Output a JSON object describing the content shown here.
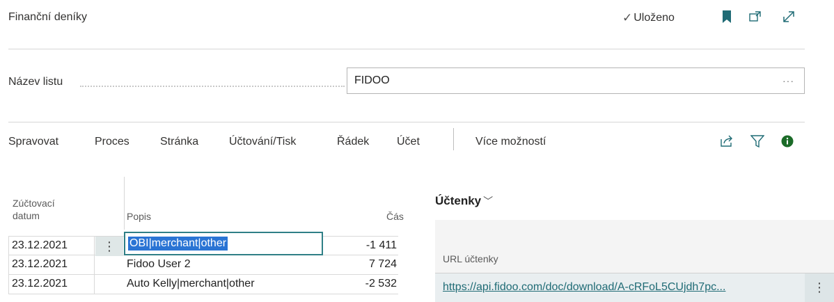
{
  "header": {
    "title": "Finanční deníky",
    "status": "Uloženo",
    "icons": [
      "check-icon",
      "bookmark-icon",
      "open-in-new-window-icon",
      "expand-icon"
    ]
  },
  "field": {
    "label": "Název listu",
    "value": "FIDOO",
    "more": "···"
  },
  "actions": {
    "items": [
      "Spravovat",
      "Proces",
      "Stránka",
      "Účtování/Tisk",
      "Řádek",
      "Účet"
    ],
    "more_label": "Více možností",
    "icons": [
      "share-icon",
      "filter-icon",
      "info-icon"
    ]
  },
  "table": {
    "headers": {
      "date_line1": "Zúčtovací",
      "date_line2": "datum",
      "description": "Popis",
      "amount": "Čás"
    },
    "rows": [
      {
        "date": "23.12.2021",
        "description": "OBI|merchant|other",
        "amount": "-1 411"
      },
      {
        "date": "23.12.2021",
        "description": "Fidoo User 2",
        "amount": "7 724"
      },
      {
        "date": "23.12.2021",
        "description": "Auto Kelly|merchant|other",
        "amount": "-2 532"
      }
    ]
  },
  "receipts": {
    "title": "Účtenky",
    "column": "URL účtenky",
    "url": "https://api.fidoo.com/doc/download/A-cRFoL5CUjdh7pc..."
  },
  "colors": {
    "accent": "#2f7f86",
    "selection": "#2a74d4",
    "link": "#1f6b75",
    "icon": "#1f6b75"
  }
}
